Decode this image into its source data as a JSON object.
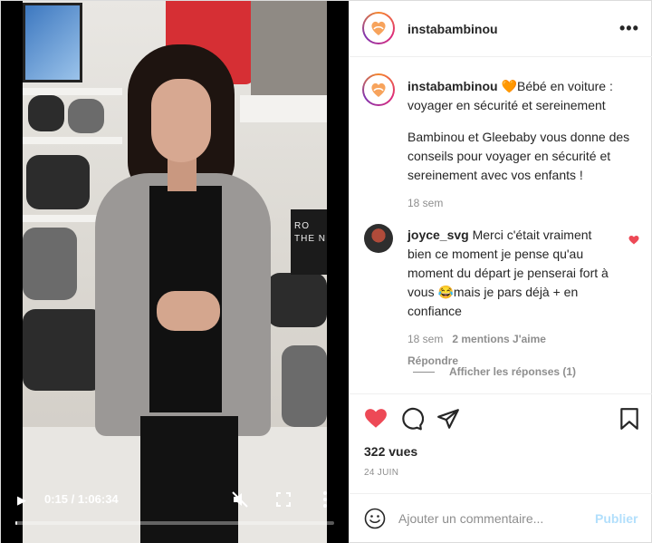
{
  "video": {
    "sign_text": "RO\nTHE N",
    "time": "0:15 / 1:06:34",
    "progress": 0.0038
  },
  "header": {
    "username": "instabambinou",
    "more_icon": "more-horizontal-icon"
  },
  "caption": {
    "username": "instabambinou",
    "emoji": "🧡",
    "text1": "Bébé en voiture : voyager en sécurité et sereinement",
    "text2": "Bambinou et Gleebaby vous donne des conseils pour voyager en sécurité et sereinement avec vos enfants !",
    "time": "18 sem"
  },
  "comment": {
    "username": "joyce_svg",
    "text": "Merci c'était vraiment bien ce moment je pense qu'au moment du départ je penserai fort à vous 😂mais je pars déjà + en confiance",
    "time": "18 sem",
    "likes": "2 mentions J'aime",
    "reply": "Répondre",
    "view_replies": "Afficher les réponses (1)"
  },
  "stats": {
    "views": "322 vues",
    "date": "24 JUIN"
  },
  "add_comment": {
    "placeholder": "Ajouter un commentaire...",
    "publish": "Publier"
  },
  "colors": {
    "like_red": "#ed4956",
    "publish_disabled": "#b2dffc",
    "meta_grey": "#8e8e8e"
  }
}
